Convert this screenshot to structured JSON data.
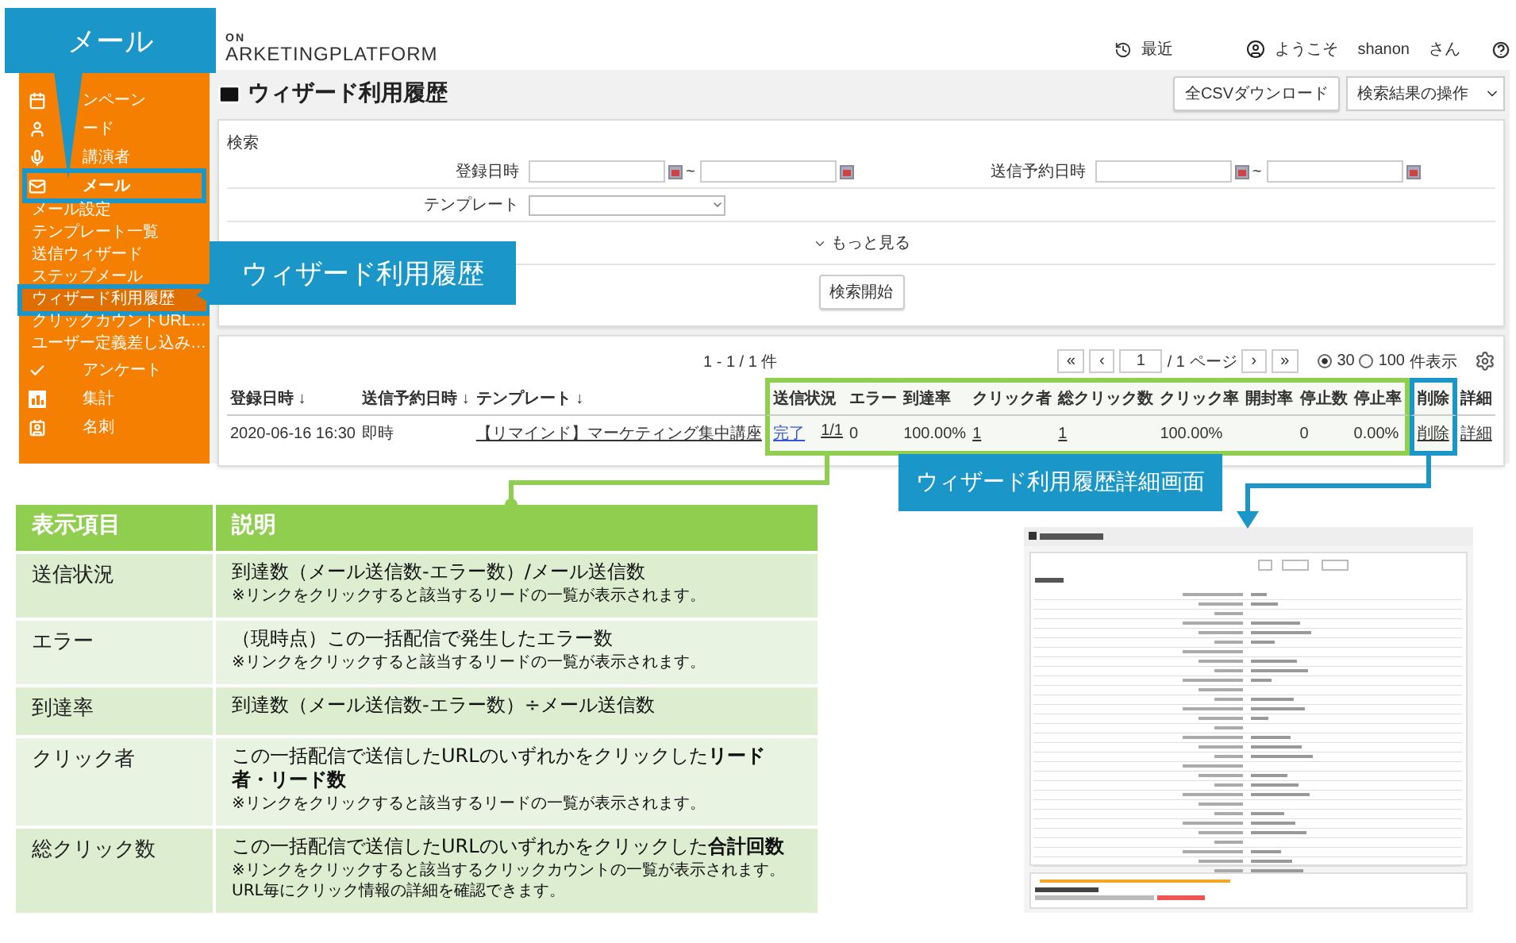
{
  "callouts": [
    {
      "text": "メール"
    },
    {
      "text": "ウィザード利用履歴"
    },
    {
      "text": "ウィザード利用履歴詳細画面"
    }
  ],
  "header": {
    "logo_small": "ON",
    "logo": "ARKETINGPLATFORM",
    "recent": "最近",
    "welcome": "ようこそ",
    "user": "shanon",
    "honorific": "さん"
  },
  "sidebar": {
    "items": [
      {
        "label": "ンペーン",
        "selected": false,
        "highlighted": false
      },
      {
        "label": "ード",
        "selected": false,
        "highlighted": false
      },
      {
        "label": "講演者",
        "selected": false,
        "highlighted": false
      },
      {
        "label": "メール",
        "selected": true,
        "highlighted": true,
        "children": [
          {
            "label": "メール設定",
            "selected": false,
            "highlighted": false
          },
          {
            "label": "テンプレート一覧",
            "selected": false,
            "highlighted": false
          },
          {
            "label": "送信ウィザード",
            "selected": false,
            "highlighted": false
          },
          {
            "label": "ステップメール",
            "selected": false,
            "highlighted": false
          },
          {
            "label": "ウィザード利用履歴",
            "selected": true,
            "highlighted": true
          },
          {
            "label": "クリックカウントURL…",
            "selected": false,
            "highlighted": false
          },
          {
            "label": "ユーザー定義差し込み…",
            "selected": false,
            "highlighted": false
          }
        ]
      },
      {
        "label": "アンケート",
        "selected": false,
        "highlighted": false
      },
      {
        "label": "集計",
        "selected": false,
        "highlighted": false
      },
      {
        "label": "名刺",
        "selected": false,
        "highlighted": false
      }
    ]
  },
  "page": {
    "title": "ウィザード利用履歴",
    "csv_button": "全CSVダウンロード",
    "actions_select": "検索結果の操作"
  },
  "search": {
    "heading": "検索",
    "ranges": [
      {
        "label": "登録日時",
        "separator": "~"
      },
      {
        "label": "送信予約日時",
        "separator": "~"
      }
    ],
    "template_label": "テンプレート",
    "more": "もっと見る",
    "submit": "検索開始"
  },
  "results": {
    "count": "1 - 1 / 1 件",
    "pager": {
      "first": "«",
      "prev": "‹",
      "page": "1",
      "pages": "/ 1 ページ",
      "next": "›",
      "last": "»"
    },
    "page_sizes": [
      {
        "label": "30",
        "selected": true
      },
      {
        "label": "100",
        "selected": false
      }
    ],
    "page_size_suffix": "件表示",
    "columns": [
      {
        "label": "登録日時 ↓"
      },
      {
        "label": "送信予約日時 ↓"
      },
      {
        "label": "テンプレート ↓"
      },
      {
        "label": "送信状況",
        "color": "#8fce4e"
      },
      {
        "label": "エラー",
        "color": "#8fce4e"
      },
      {
        "label": "到達率",
        "color": "#8fce4e"
      },
      {
        "label": "クリック者",
        "color": "#8fce4e"
      },
      {
        "label": "総クリック数",
        "color": "#8fce4e"
      },
      {
        "label": "クリック率",
        "color": "#8fce4e"
      },
      {
        "label": "開封率",
        "color": "#8fce4e"
      },
      {
        "label": "停止数",
        "color": "#8fce4e"
      },
      {
        "label": "停止率",
        "color": "#8fce4e"
      },
      {
        "label": "削除",
        "color": "#1a96c8"
      },
      {
        "label": "詳細"
      }
    ],
    "rows": [
      {
        "cells": [
          {
            "kind": "text",
            "text": "2020-06-16 16:30"
          },
          {
            "kind": "text",
            "text": "即時"
          },
          {
            "kind": "link",
            "text": "【リマインド】マーケティング集中講座"
          },
          {
            "kind": "status",
            "text": "完了",
            "count": "1/1"
          },
          {
            "kind": "text",
            "text": "0"
          },
          {
            "kind": "text",
            "text": "100.00%"
          },
          {
            "kind": "link",
            "text": "1"
          },
          {
            "kind": "link",
            "text": "1"
          },
          {
            "kind": "text",
            "text": "100.00%"
          },
          {
            "kind": "empty"
          },
          {
            "kind": "text",
            "text": "0"
          },
          {
            "kind": "text",
            "text": "0.00%"
          },
          {
            "kind": "link",
            "text": "削除"
          },
          {
            "kind": "link",
            "text": "詳細"
          }
        ]
      }
    ]
  },
  "legend": {
    "columns": [
      "表示項目",
      "説明"
    ],
    "rows": [
      {
        "item": "送信状況",
        "lines": [
          "到達数（メール送信数-エラー数）/メール送信数"
        ],
        "notes": [
          "※リンクをクリックすると該当するリードの一覧が表示されます。"
        ]
      },
      {
        "item": "エラー",
        "lines": [
          "（現時点）この一括配信で発生したエラー数"
        ],
        "notes": [
          "※リンクをクリックすると該当するリードの一覧が表示されます。"
        ]
      },
      {
        "item": "到達率",
        "lines": [
          "到達数（メール送信数-エラー数）÷メール送信数"
        ],
        "notes": []
      },
      {
        "item": "クリック者",
        "lines": [
          "この一括配信で送信したURLのいずれかをクリックした**リード者・リード数**"
        ],
        "notes": [
          "※リンクをクリックすると該当するリードの一覧が表示されます。"
        ]
      },
      {
        "item": "総クリック数",
        "lines": [
          "この一括配信で送信したURLのいずれかをクリックした**合計回数**"
        ],
        "notes": [
          "※リンクをクリックすると該当するクリックカウントの一覧が表示されます。",
          "URL毎にクリック情報の詳細を確認できます。"
        ]
      }
    ]
  }
}
